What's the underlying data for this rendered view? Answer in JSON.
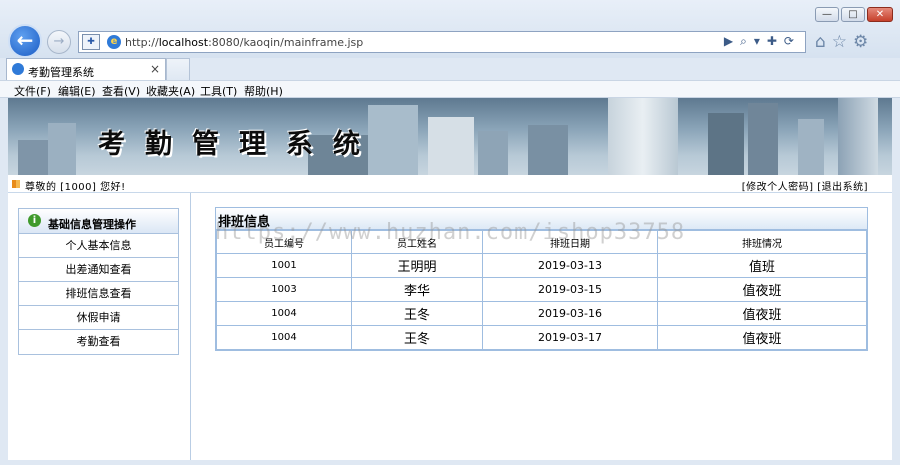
{
  "window": {
    "min_label": "—",
    "max_label": "□",
    "close_label": "✕"
  },
  "address": {
    "scheme": "http://",
    "host": "localhost",
    "rest": ":8080/kaoqin/mainframe.jsp",
    "tools": "▶⌕▾✚⟳"
  },
  "browser_icons": [
    "home-icon",
    "star-icon",
    "gear-icon"
  ],
  "tab": {
    "title": "考勤管理系统",
    "close": "×"
  },
  "menu": [
    "文件(F)",
    "编辑(E)",
    "查看(V)",
    "收藏夹(A)",
    "工具(T)",
    "帮助(H)"
  ],
  "banner": {
    "title": "考勤管理系统"
  },
  "welcome": "尊敬的 [1000] 您好!",
  "top_links": {
    "change_password": "[修改个人密码]",
    "logout": "[退出系统]"
  },
  "sidebar": {
    "header": "基础信息管理操作",
    "items": [
      "个人基本信息",
      "出差通知查看",
      "排班信息查看",
      "休假申请",
      "考勤查看"
    ]
  },
  "schedule": {
    "title": "排班信息",
    "columns": [
      "员工编号",
      "员工姓名",
      "排班日期",
      "排班情况"
    ],
    "rows": [
      [
        "1001",
        "王明明",
        "2019-03-13",
        "值班"
      ],
      [
        "1003",
        "李华",
        "2019-03-15",
        "值夜班"
      ],
      [
        "1004",
        "王冬",
        "2019-03-16",
        "值夜班"
      ],
      [
        "1004",
        "王冬",
        "2019-03-17",
        "值夜班"
      ]
    ]
  },
  "watermark": "https://www.huzhan.com/ishop33758",
  "colors": {
    "accent": "#1b5cc4",
    "panel_border": "#9fbde0",
    "page_bg": "#ffffff"
  }
}
